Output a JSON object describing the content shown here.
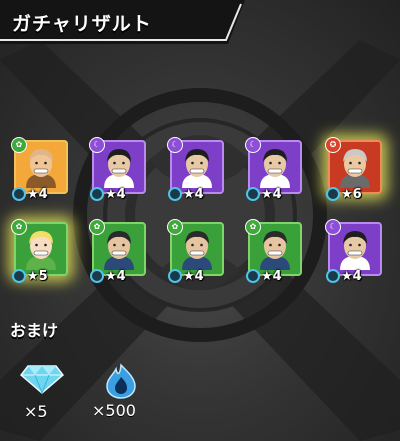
{
  "header": {
    "title": "ガチャリザルト"
  },
  "results": [
    {
      "element": "green",
      "frame": "gold",
      "rarity": "★4",
      "highlight": false,
      "portrait": "bald-mustache-man"
    },
    {
      "element": "purple",
      "frame": "purple",
      "rarity": "★4",
      "highlight": false,
      "portrait": "long-hair-grin-man"
    },
    {
      "element": "purple",
      "frame": "purple",
      "rarity": "★4",
      "highlight": false,
      "portrait": "long-hair-grin-man"
    },
    {
      "element": "purple",
      "frame": "purple",
      "rarity": "★4",
      "highlight": false,
      "portrait": "long-hair-grin-man"
    },
    {
      "element": "red",
      "frame": "red",
      "rarity": "★6",
      "highlight": true,
      "portrait": "old-general"
    },
    {
      "element": "green",
      "frame": "green",
      "rarity": "★5",
      "highlight": true,
      "portrait": "blonde-girl"
    },
    {
      "element": "green",
      "frame": "green",
      "rarity": "★4",
      "highlight": false,
      "portrait": "glasses-man"
    },
    {
      "element": "green",
      "frame": "green",
      "rarity": "★4",
      "highlight": false,
      "portrait": "glasses-man"
    },
    {
      "element": "green",
      "frame": "green",
      "rarity": "★4",
      "highlight": false,
      "portrait": "glasses-man"
    },
    {
      "element": "purple",
      "frame": "purple",
      "rarity": "★4",
      "highlight": false,
      "portrait": "long-hair-grin-man"
    }
  ],
  "bonus": {
    "label": "おまけ",
    "items": [
      {
        "icon": "gem-icon",
        "quantity": "×5"
      },
      {
        "icon": "soul-flame-icon",
        "quantity": "×500"
      }
    ]
  },
  "colors": {
    "gold": "#f2b233",
    "purple": "#8e4fd8",
    "green": "#3faa3a",
    "red": "#d9442a",
    "star_ring": "#4fc3e8"
  }
}
